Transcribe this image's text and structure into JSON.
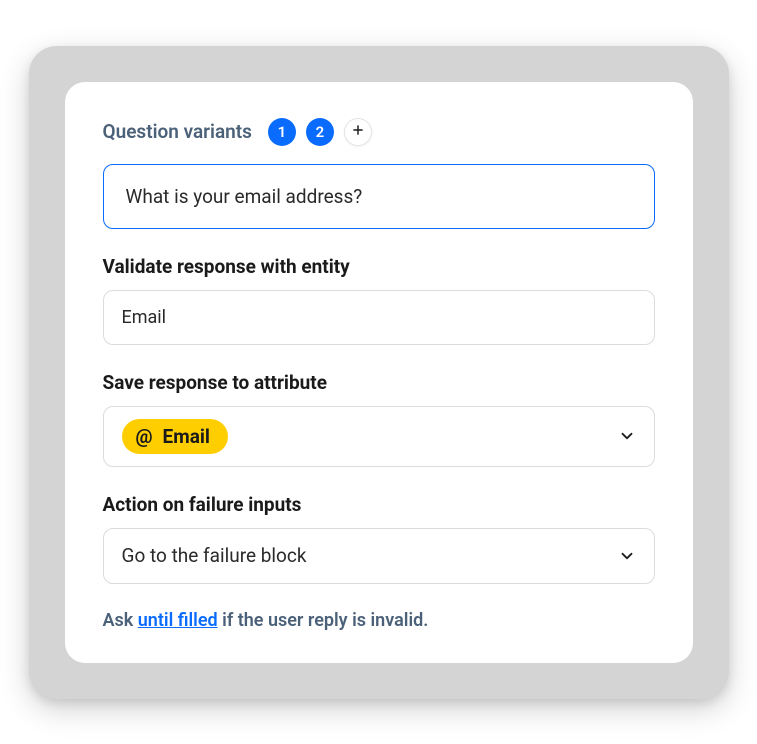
{
  "variants": {
    "label": "Question variants",
    "badge1": "1",
    "badge2": "2"
  },
  "question": {
    "value": "What is your email address?"
  },
  "validate": {
    "label": "Validate response with entity",
    "value": "Email"
  },
  "save": {
    "label": "Save response to attribute",
    "pill_prefix": "@",
    "pill_text": "Email"
  },
  "failure": {
    "label": "Action on failure inputs",
    "value": "Go to the failure block"
  },
  "footer": {
    "part1": "Ask ",
    "link": "until filled",
    "part2": " if the user reply is invalid."
  }
}
